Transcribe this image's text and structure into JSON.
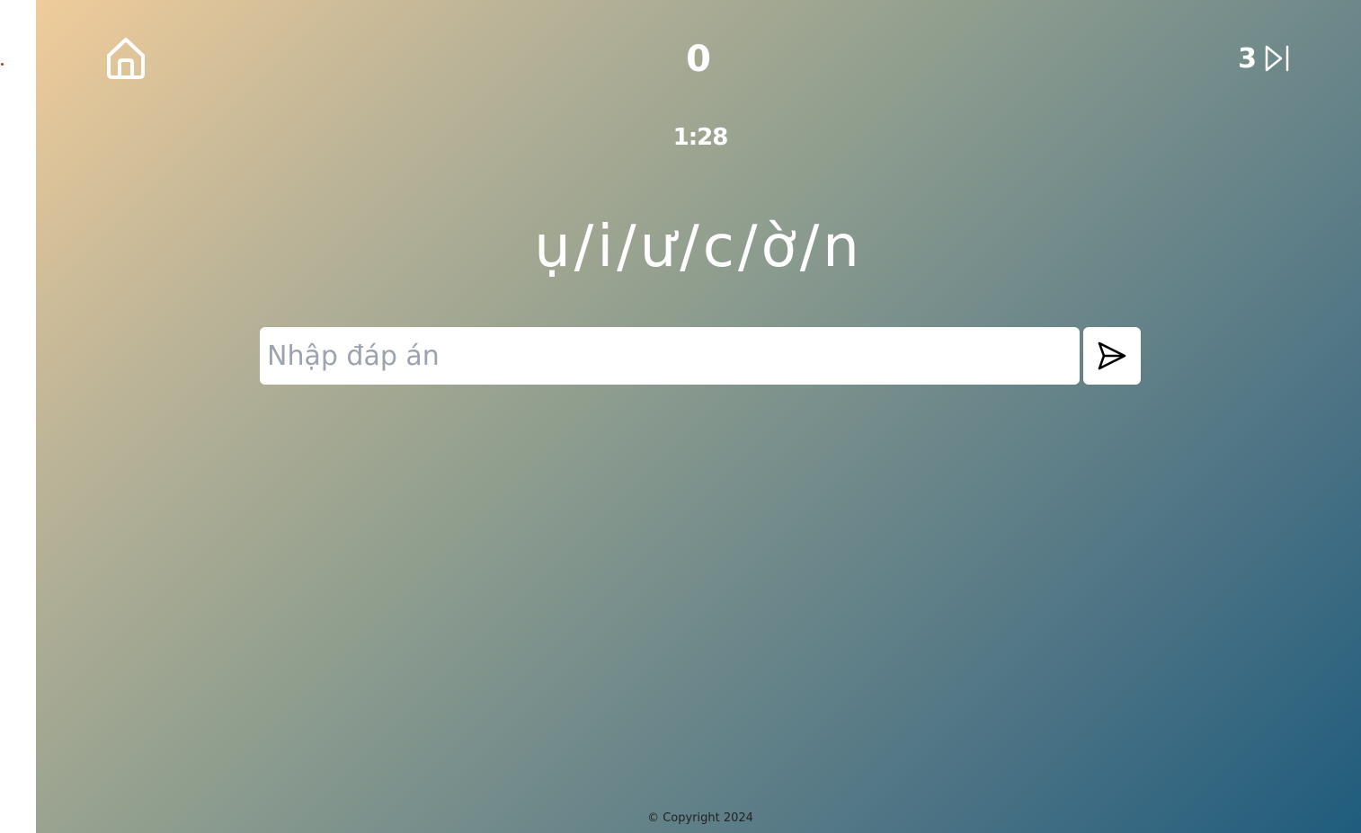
{
  "header": {
    "home_icon": "home-icon",
    "score": "0",
    "skips_remaining": "3",
    "skip_icon": "skip-forward-icon"
  },
  "game": {
    "timer": "1:28",
    "scrambled_word": "ụ/i/ư/c/ờ/n",
    "answer_placeholder": "Nhập đáp án",
    "answer_value": "",
    "send_icon": "send-icon"
  },
  "footer": {
    "copyright": "© Copyright 2024"
  },
  "colors": {
    "gradient_start": "#f0cc9a",
    "gradient_end": "#1f5c7d",
    "text": "#ffffff",
    "placeholder": "#9ca3af"
  }
}
